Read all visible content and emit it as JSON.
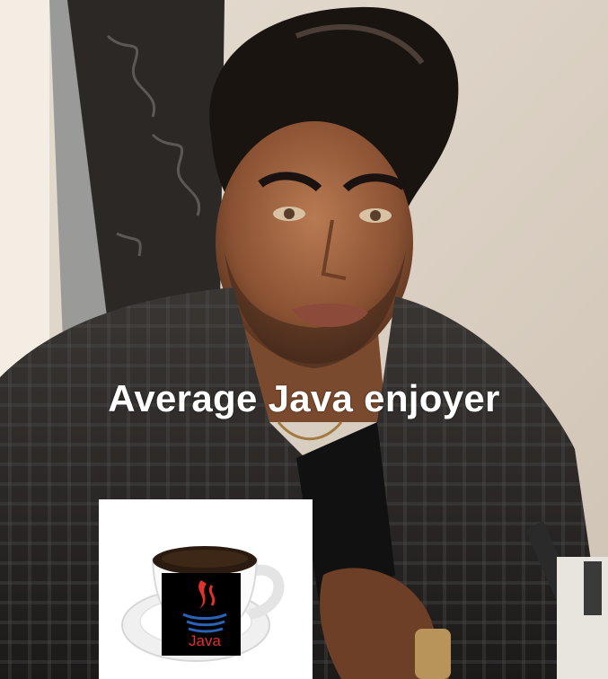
{
  "meme": {
    "caption": "Average Java enjoyer",
    "logo_text": "Java"
  },
  "colors": {
    "caption": "#ffffff",
    "logo_red": "#e0312b",
    "logo_blue": "#2a63b8",
    "coffee": "#2a1a10"
  },
  "icons": {
    "logo": "java-coffee-cup-icon"
  }
}
